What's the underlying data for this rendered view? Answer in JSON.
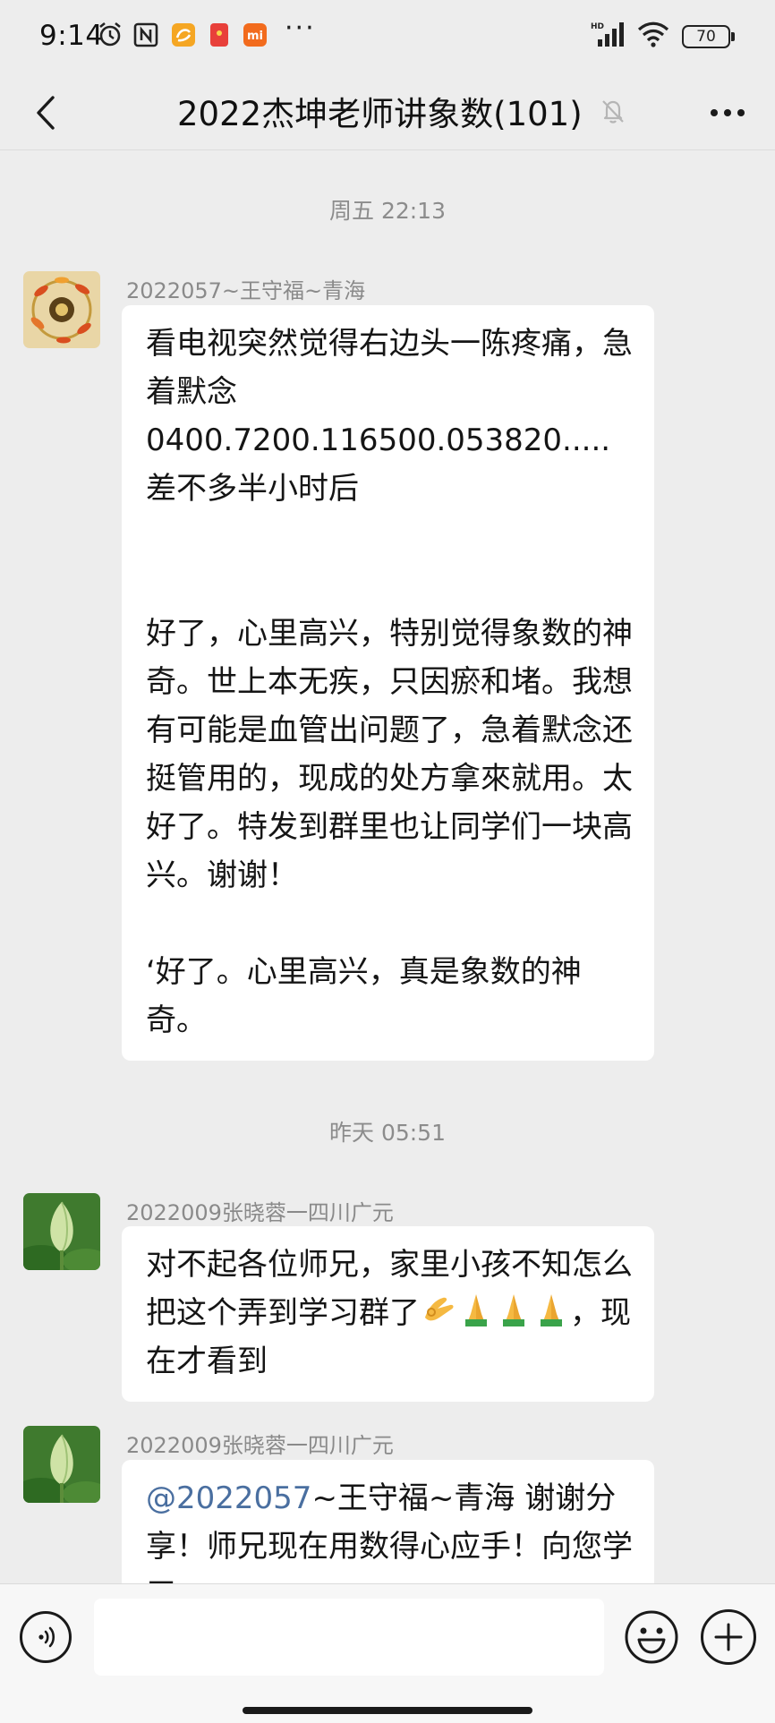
{
  "status_bar": {
    "time": "9:14",
    "network_label": "HD",
    "battery": "70"
  },
  "header": {
    "title": "2022杰坤老师讲象数(101)"
  },
  "messages": {
    "timestamp1": "周五 22:13",
    "msg1": {
      "sender": "2022057~王守福~青海",
      "line1": "看电视突然觉得右边头一陈疼痛，急着默念",
      "line2": "0400.7200.116500.053820.....差不多半小时后",
      "line3": "好了，心里高兴，特别觉得象数的神奇。世上本无疾，只因瘀和堵。我想有可能是血管出问题了，急着默念还挺管用的，现成的处方拿來就用。太好了。特发到群里也让同学们一块高兴。谢谢！",
      "line4": "‘好了。心里高兴，真是象数的神奇。"
    },
    "timestamp2": "昨天 05:51",
    "msg2": {
      "sender": "2022009张晓蓉一四川广元",
      "text_a": "对不起各位师兄，家里小孩不知怎么把这个弄到学习群了",
      "text_b": "，现在才看到"
    },
    "msg3": {
      "sender": "2022009张晓蓉一四川广元",
      "mention": "@2022057",
      "text": "~王守福~青海  谢谢分享！师兄现在用数得心应手！向您学习"
    }
  },
  "icons": {
    "back": "chevron-left-icon",
    "mute": "bell-off-icon",
    "more": "more-dots-icon",
    "voice": "voice-icon",
    "emoji": "smiley-icon",
    "plus": "plus-icon"
  },
  "colors": {
    "background": "#ededed",
    "bubble": "#ffffff",
    "mention": "#4a6fa0"
  }
}
